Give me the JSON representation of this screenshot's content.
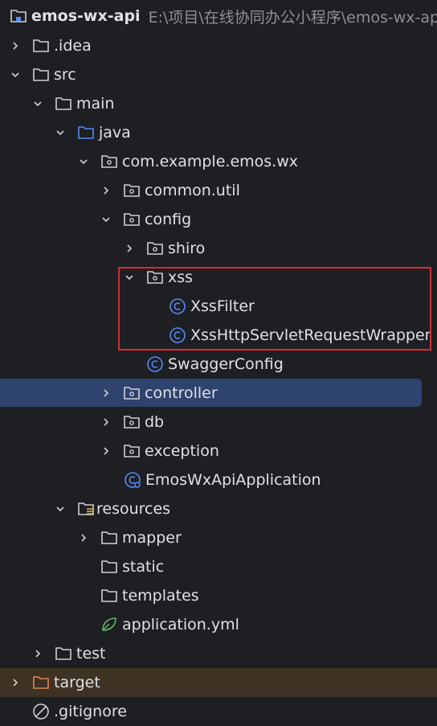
{
  "root": {
    "name": "emos-wx-api",
    "path": "E:\\项目\\在线协同办公小程序\\emos-wx-api"
  },
  "items": [
    {
      "label": ".idea"
    },
    {
      "label": "src"
    },
    {
      "label": "main"
    },
    {
      "label": "java"
    },
    {
      "label": "com.example.emos.wx"
    },
    {
      "label": "common.util"
    },
    {
      "label": "config"
    },
    {
      "label": "shiro"
    },
    {
      "label": "xss"
    },
    {
      "label": "XssFilter"
    },
    {
      "label": "XssHttpServletRequestWrapper"
    },
    {
      "label": "SwaggerConfig"
    },
    {
      "label": "controller"
    },
    {
      "label": "db"
    },
    {
      "label": "exception"
    },
    {
      "label": "EmosWxApiApplication"
    },
    {
      "label": "resources"
    },
    {
      "label": "mapper"
    },
    {
      "label": "static"
    },
    {
      "label": "templates"
    },
    {
      "label": "application.yml"
    },
    {
      "label": "test"
    },
    {
      "label": "target"
    },
    {
      "label": ".gitignore"
    }
  ],
  "colors": {
    "background": "#1e1f22",
    "selection": "#2e436e",
    "excluded_row": "#3d3223",
    "highlight_box": "#e5252c",
    "class_icon": "#548af7",
    "folder_icon": "#ced0d6",
    "source_folder_icon": "#548af7",
    "excluded_folder_icon": "#e08855",
    "spring_icon": "#5fb865"
  },
  "icons": {
    "collapsed_arrow": "chevron-right-icon",
    "expanded_arrow": "chevron-down-icon",
    "folder": "folder-icon",
    "package": "package-icon",
    "class": "class-icon",
    "spring_config": "spring-yaml-icon",
    "ignore_file": "ignore-file-icon"
  }
}
